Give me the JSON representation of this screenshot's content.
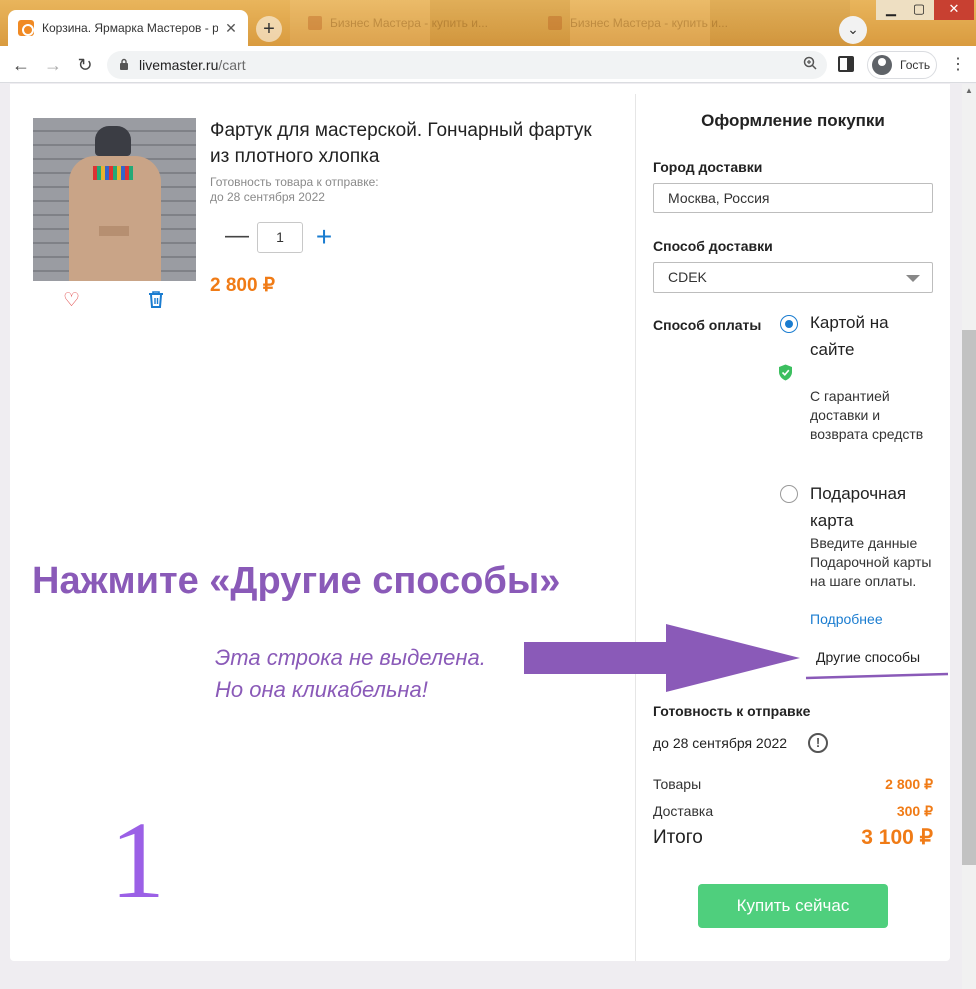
{
  "browser": {
    "tab_title": "Корзина. Ярмарка Мастеров - р",
    "tab_close": "✕",
    "new_tab": "+",
    "ghost_tabs": [
      "Бизнес Мастера - купить и...",
      "Бизнес Мастера - купить и..."
    ],
    "url_host": "livemaster.ru",
    "url_path": "/cart",
    "profile_label": "Гость",
    "window_controls": {
      "minimize": "▁",
      "maximize": "▢",
      "close": "✕"
    },
    "icons": [
      "back-arrow-icon",
      "forward-arrow-icon",
      "reload-icon",
      "lock-icon",
      "zoom-icon",
      "side-panel-icon",
      "avatar-icon",
      "menu-dots-icon"
    ]
  },
  "product": {
    "title": "Фартук для мастерской. Гончарный фартук из плотного хлопка",
    "readiness_label": "Готовность товара к отправке:",
    "readiness_date": "до 28 сентября 2022",
    "quantity": "1",
    "price": "2 800 ₽",
    "icons": {
      "favorite": "heart-icon",
      "delete": "trash-icon",
      "minus": "minus-icon",
      "plus": "plus-icon"
    }
  },
  "checkout": {
    "title": "Оформление покупки",
    "city_label": "Город доставки",
    "city_value": "Москва, Россия",
    "delivery_label": "Способ доставки",
    "delivery_value": "CDEK",
    "payment_label": "Способ оплаты",
    "payment_options": [
      {
        "title": "Картой на сайте",
        "selected": true,
        "description": "С гарантией доставки и возврата средств"
      },
      {
        "title": "Подарочная карта",
        "selected": false,
        "description": "Введите данные Подарочной карты на шаге оплаты."
      }
    ],
    "more_link": "Подробнее",
    "other_ways": "Другие способы",
    "ready_label": "Готовность к отправке",
    "ready_date": "до 28 сентября 2022",
    "goods_label": "Товары",
    "goods_value": "2 800 ₽",
    "delivery_cost_label": "Доставка",
    "delivery_cost_value": "300 ₽",
    "total_label": "Итого",
    "total_value": "3 100 ₽",
    "buy_button": "Купить сейчас"
  },
  "annotation": {
    "headline": "Нажмите «Другие способы»",
    "note_line1": "Эта строка не выделена.",
    "note_line2": "Но она кликабельна!",
    "step_number": "1",
    "color": "#8a5ab8"
  },
  "colors": {
    "accent_orange": "#f07b16",
    "link_blue": "#1a7cd0",
    "buy_green": "#4fcf7d",
    "annotation_purple": "#8a5ab8"
  }
}
